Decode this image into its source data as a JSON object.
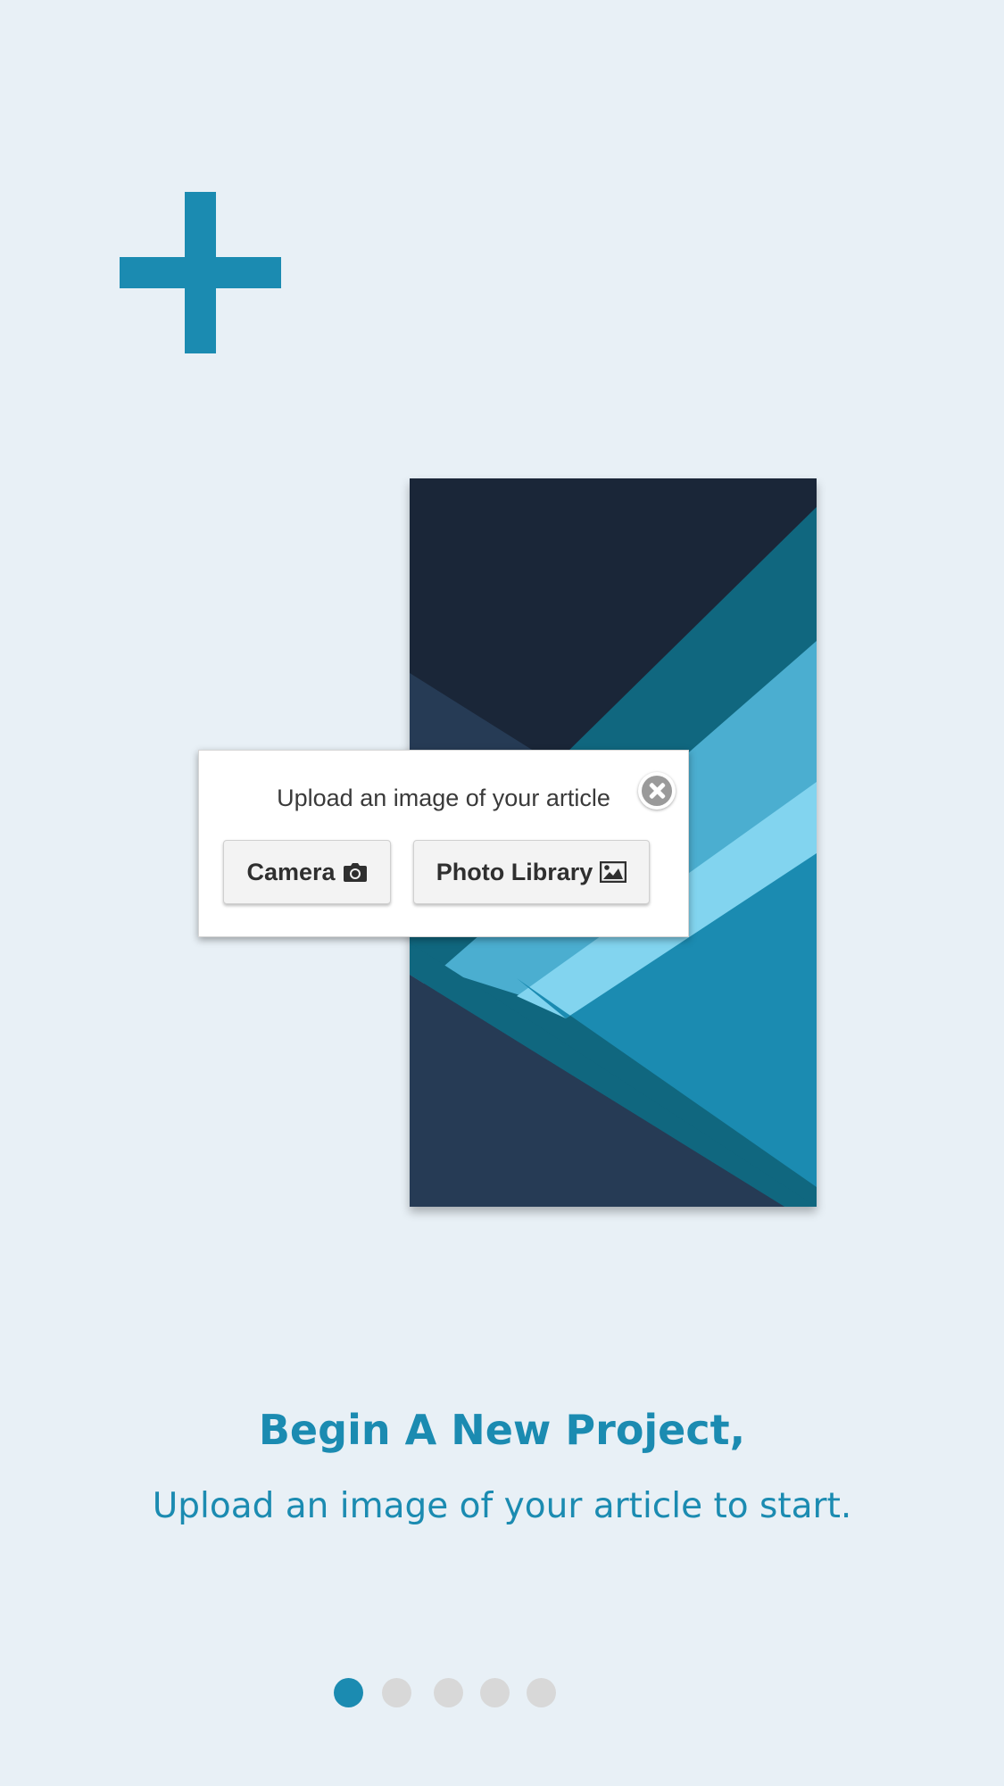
{
  "colors": {
    "accent": "#1b8bb1",
    "background": "#e8f0f6",
    "dot_inactive": "#d8d8d8"
  },
  "hero_icon": "plus-icon",
  "dialog": {
    "title": "Upload an image of your article",
    "close_icon": "close-icon",
    "camera_label": "Camera",
    "camera_icon": "camera-icon",
    "library_label": "Photo Library",
    "library_icon": "image-icon"
  },
  "onboarding": {
    "headline": "Begin A New Project,",
    "subline": "Upload an image of your article to start."
  },
  "pager": {
    "total": 5,
    "current": 1
  }
}
